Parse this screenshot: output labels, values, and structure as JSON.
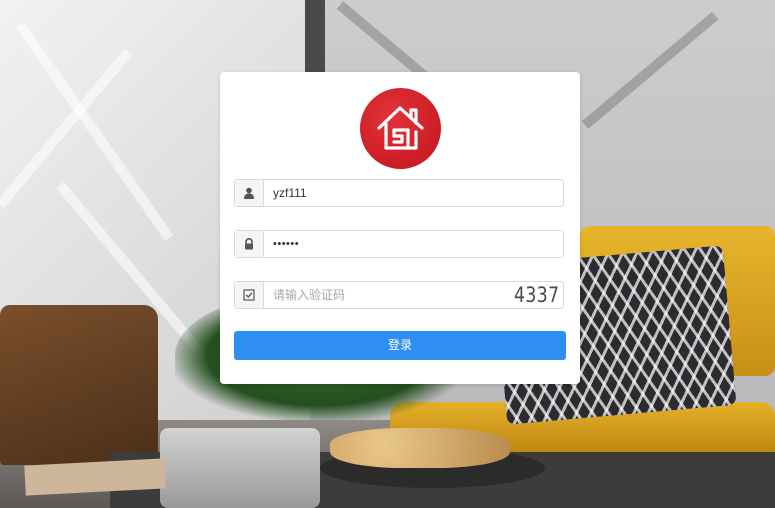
{
  "login": {
    "username": {
      "value": "yzf111",
      "icon": "user-icon"
    },
    "password": {
      "value": "••••••",
      "icon": "lock-icon"
    },
    "captcha": {
      "placeholder": "请输入验证码",
      "value": "",
      "code": "4337",
      "icon": "checkbox-icon"
    },
    "submit_label": "登录",
    "logo_icon": "house-logo-icon"
  },
  "colors": {
    "primary": "#2F8FF0",
    "logo_red": "#D0202A",
    "card_bg": "#FFFFFF"
  }
}
